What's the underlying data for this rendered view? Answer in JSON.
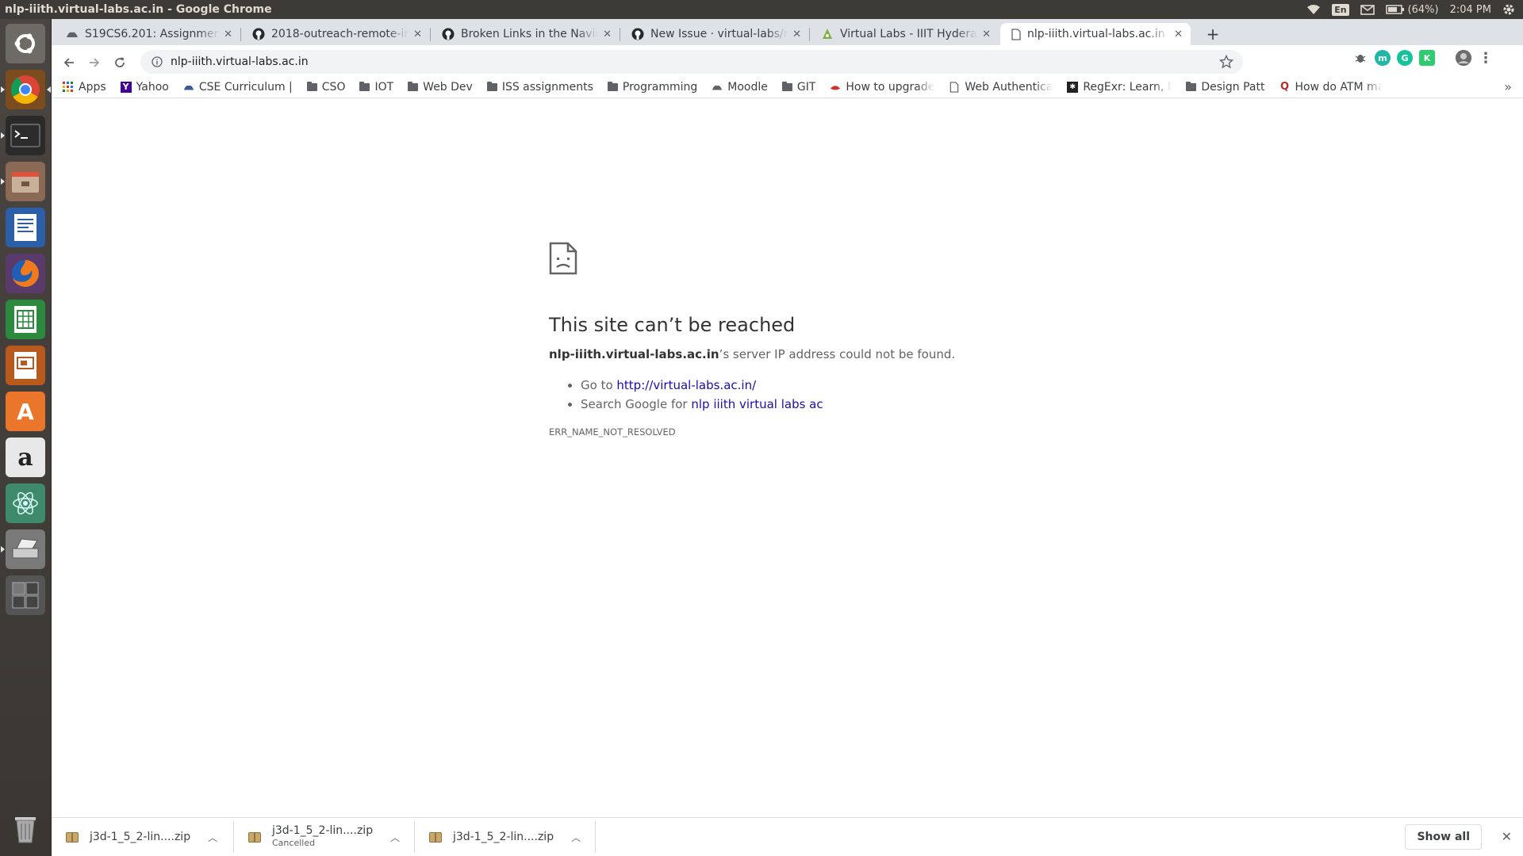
{
  "system": {
    "window_title": "nlp-iiith.virtual-labs.ac.in - Google Chrome",
    "keyboard_lang": "En",
    "battery": "(64%)",
    "clock": "2:04 PM"
  },
  "launcher": {
    "items": [
      "ubuntu-dash",
      "chrome",
      "terminal",
      "files",
      "writer",
      "firefox",
      "calc",
      "impress",
      "software-center",
      "amazon",
      "atom",
      "scanner",
      "workspaces",
      "trash"
    ]
  },
  "tabs": [
    {
      "title": "S19CS6.201: Assignment-",
      "active": false
    },
    {
      "title": "2018-outreach-remote-int",
      "active": false
    },
    {
      "title": "Broken Links in the Navig",
      "active": false
    },
    {
      "title": "New Issue · virtual-labs/n",
      "active": false
    },
    {
      "title": "Virtual Labs - IIIT Hyderab",
      "active": false
    },
    {
      "title": "nlp-iiith.virtual-labs.ac.in",
      "active": true
    }
  ],
  "omnibox": {
    "url": "nlp-iiith.virtual-labs.ac.in"
  },
  "bookmarks": [
    {
      "label": "Apps",
      "icon": "apps-grid-icon"
    },
    {
      "label": "Yahoo",
      "icon": "yahoo-icon"
    },
    {
      "label": "CSE Curriculum |",
      "icon": "site-icon"
    },
    {
      "label": "CSO",
      "icon": "folder-icon"
    },
    {
      "label": "IOT",
      "icon": "folder-icon"
    },
    {
      "label": "Web Dev",
      "icon": "folder-icon"
    },
    {
      "label": "ISS assignments",
      "icon": "folder-icon"
    },
    {
      "label": "Programming",
      "icon": "folder-icon"
    },
    {
      "label": "Moodle",
      "icon": "moodle-icon"
    },
    {
      "label": "GIT",
      "icon": "folder-icon"
    },
    {
      "label": "How to upgrade",
      "icon": "site-icon"
    },
    {
      "label": "Web Authentica",
      "icon": "page-icon"
    },
    {
      "label": "RegExr: Learn, B",
      "icon": "regexr-icon"
    },
    {
      "label": "Design Patt",
      "icon": "folder-icon"
    },
    {
      "label": "How do ATM ma",
      "icon": "quora-icon"
    }
  ],
  "error": {
    "title": "This site can’t be reached",
    "host": "nlp-iiith.virtual-labs.ac.in",
    "desc_suffix": "’s server IP address could not be found.",
    "go_to_prefix": "Go to ",
    "go_to_link": "http://virtual-labs.ac.in/",
    "search_prefix": "Search Google for ",
    "search_link": "nlp iiith virtual labs ac",
    "code": "ERR_NAME_NOT_RESOLVED"
  },
  "downloads": {
    "items": [
      {
        "name": "j3d-1_5_2-lin....zip",
        "status": ""
      },
      {
        "name": "j3d-1_5_2-lin....zip",
        "status": "Cancelled"
      },
      {
        "name": "j3d-1_5_2-lin....zip",
        "status": ""
      }
    ],
    "show_all_label": "Show all"
  }
}
